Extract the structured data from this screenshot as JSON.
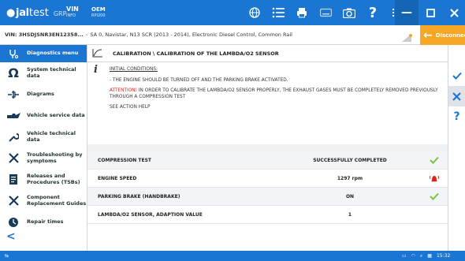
{
  "topbar": {
    "brand": "jal",
    "brand_suffix": "test",
    "brand_sub": "GRP",
    "vin_label": "VIN",
    "vin_sub": "INFO",
    "oem_label": "OEM",
    "oem_sub": "RPI200"
  },
  "vehicle": {
    "vin": "VIN: 3HSDJSNR3EN12358...",
    "description": "SA 0, Navistar, N13 SCR (2013 - 2014), Electronic Diesel Control, Common Rail",
    "disconnect_label": "Disconnect"
  },
  "sidebar": {
    "header": "Diagnostics menu",
    "items": [
      {
        "label": "System technical data",
        "icon": "omega-icon"
      },
      {
        "label": "Diagrams",
        "icon": "diagram-icon"
      },
      {
        "label": "Vehicle service data",
        "icon": "oil-can-icon"
      },
      {
        "label": "Vehicle technical data",
        "icon": "wrench-icon"
      },
      {
        "label": "Troubleshooting by symptoms",
        "icon": "tools-icon"
      },
      {
        "label": "Releases and Procedures (TSBs)",
        "icon": "document-icon"
      },
      {
        "label": "Component Replacement Guides",
        "icon": "tools-icon"
      },
      {
        "label": "Repair times",
        "icon": "clock-icon"
      }
    ]
  },
  "main": {
    "title": "CALIBRATION \\ CALIBRATION OF THE LAMBDA/O2 SENSOR",
    "info": {
      "heading": "INITIAL CONDITIONS:",
      "line1": "- THE ENGINE SHOULD BE TURNED OFF AND THE PARKING BRAKE ACTIVATED.",
      "warning": "ATTENTION!",
      "line2": " IN ORDER TO CALIBRATE THE LAMBDA/O2 SENSOR  PROPERLY, THE EXHAUST GASES MUST BE COMPLETELY REMOVED PREVIOUSLY THROUGH A COMPRESSION TEST",
      "line3": "SEE ACTION HELP"
    },
    "rows": [
      {
        "label": "COMPRESSION TEST",
        "value": "SUCCESSFULLY COMPLETED",
        "status": "ok"
      },
      {
        "label": "ENGINE SPEED",
        "value": "1297 rpm",
        "status": "alarm"
      },
      {
        "label": "PARKING BRAKE (HANDBRAKE)",
        "value": "ON",
        "status": "ok"
      },
      {
        "label": "LAMBDA/O2 SENSOR, ADAPTION VALUE",
        "value": "1",
        "status": "none"
      }
    ]
  },
  "statusbar": {
    "time": "15:32"
  },
  "colors": {
    "primary": "#1a76d2",
    "accent": "#f5a623",
    "ok": "#7cc242",
    "alarm": "#d8261f"
  }
}
